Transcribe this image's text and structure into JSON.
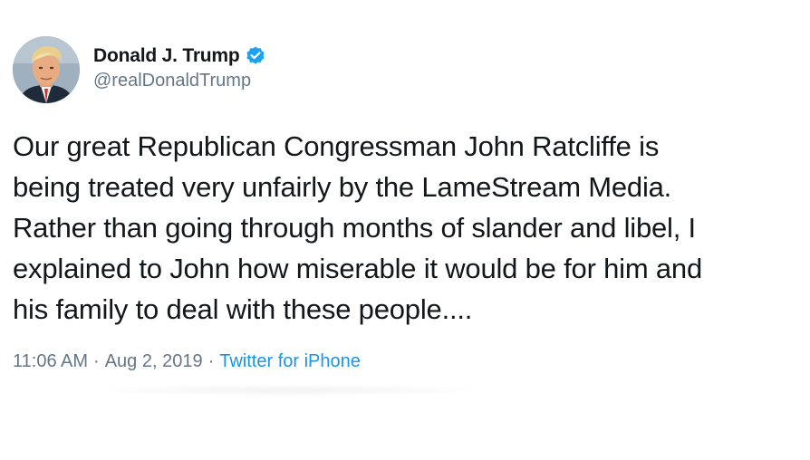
{
  "tweet": {
    "author": {
      "display_name": "Donald J. Trump",
      "handle": "@realDonaldTrump",
      "verified": true,
      "avatar_icon": "profile-photo-avatar"
    },
    "text": "Our great Republican Congressman John Ratcliffe is\nbeing treated very unfairly by the LameStream Media.\nRather than going through months of slander and libel, I\nexplained to John how miserable it would be for him and\nhis family to deal with these people....",
    "time": "11:06 AM",
    "separator": "·",
    "date": "Aug 2, 2019",
    "source": "Twitter for iPhone"
  },
  "colors": {
    "text": "#14171a",
    "secondary": "#657786",
    "link": "#1b95e0",
    "verified": "#1da1f2"
  }
}
